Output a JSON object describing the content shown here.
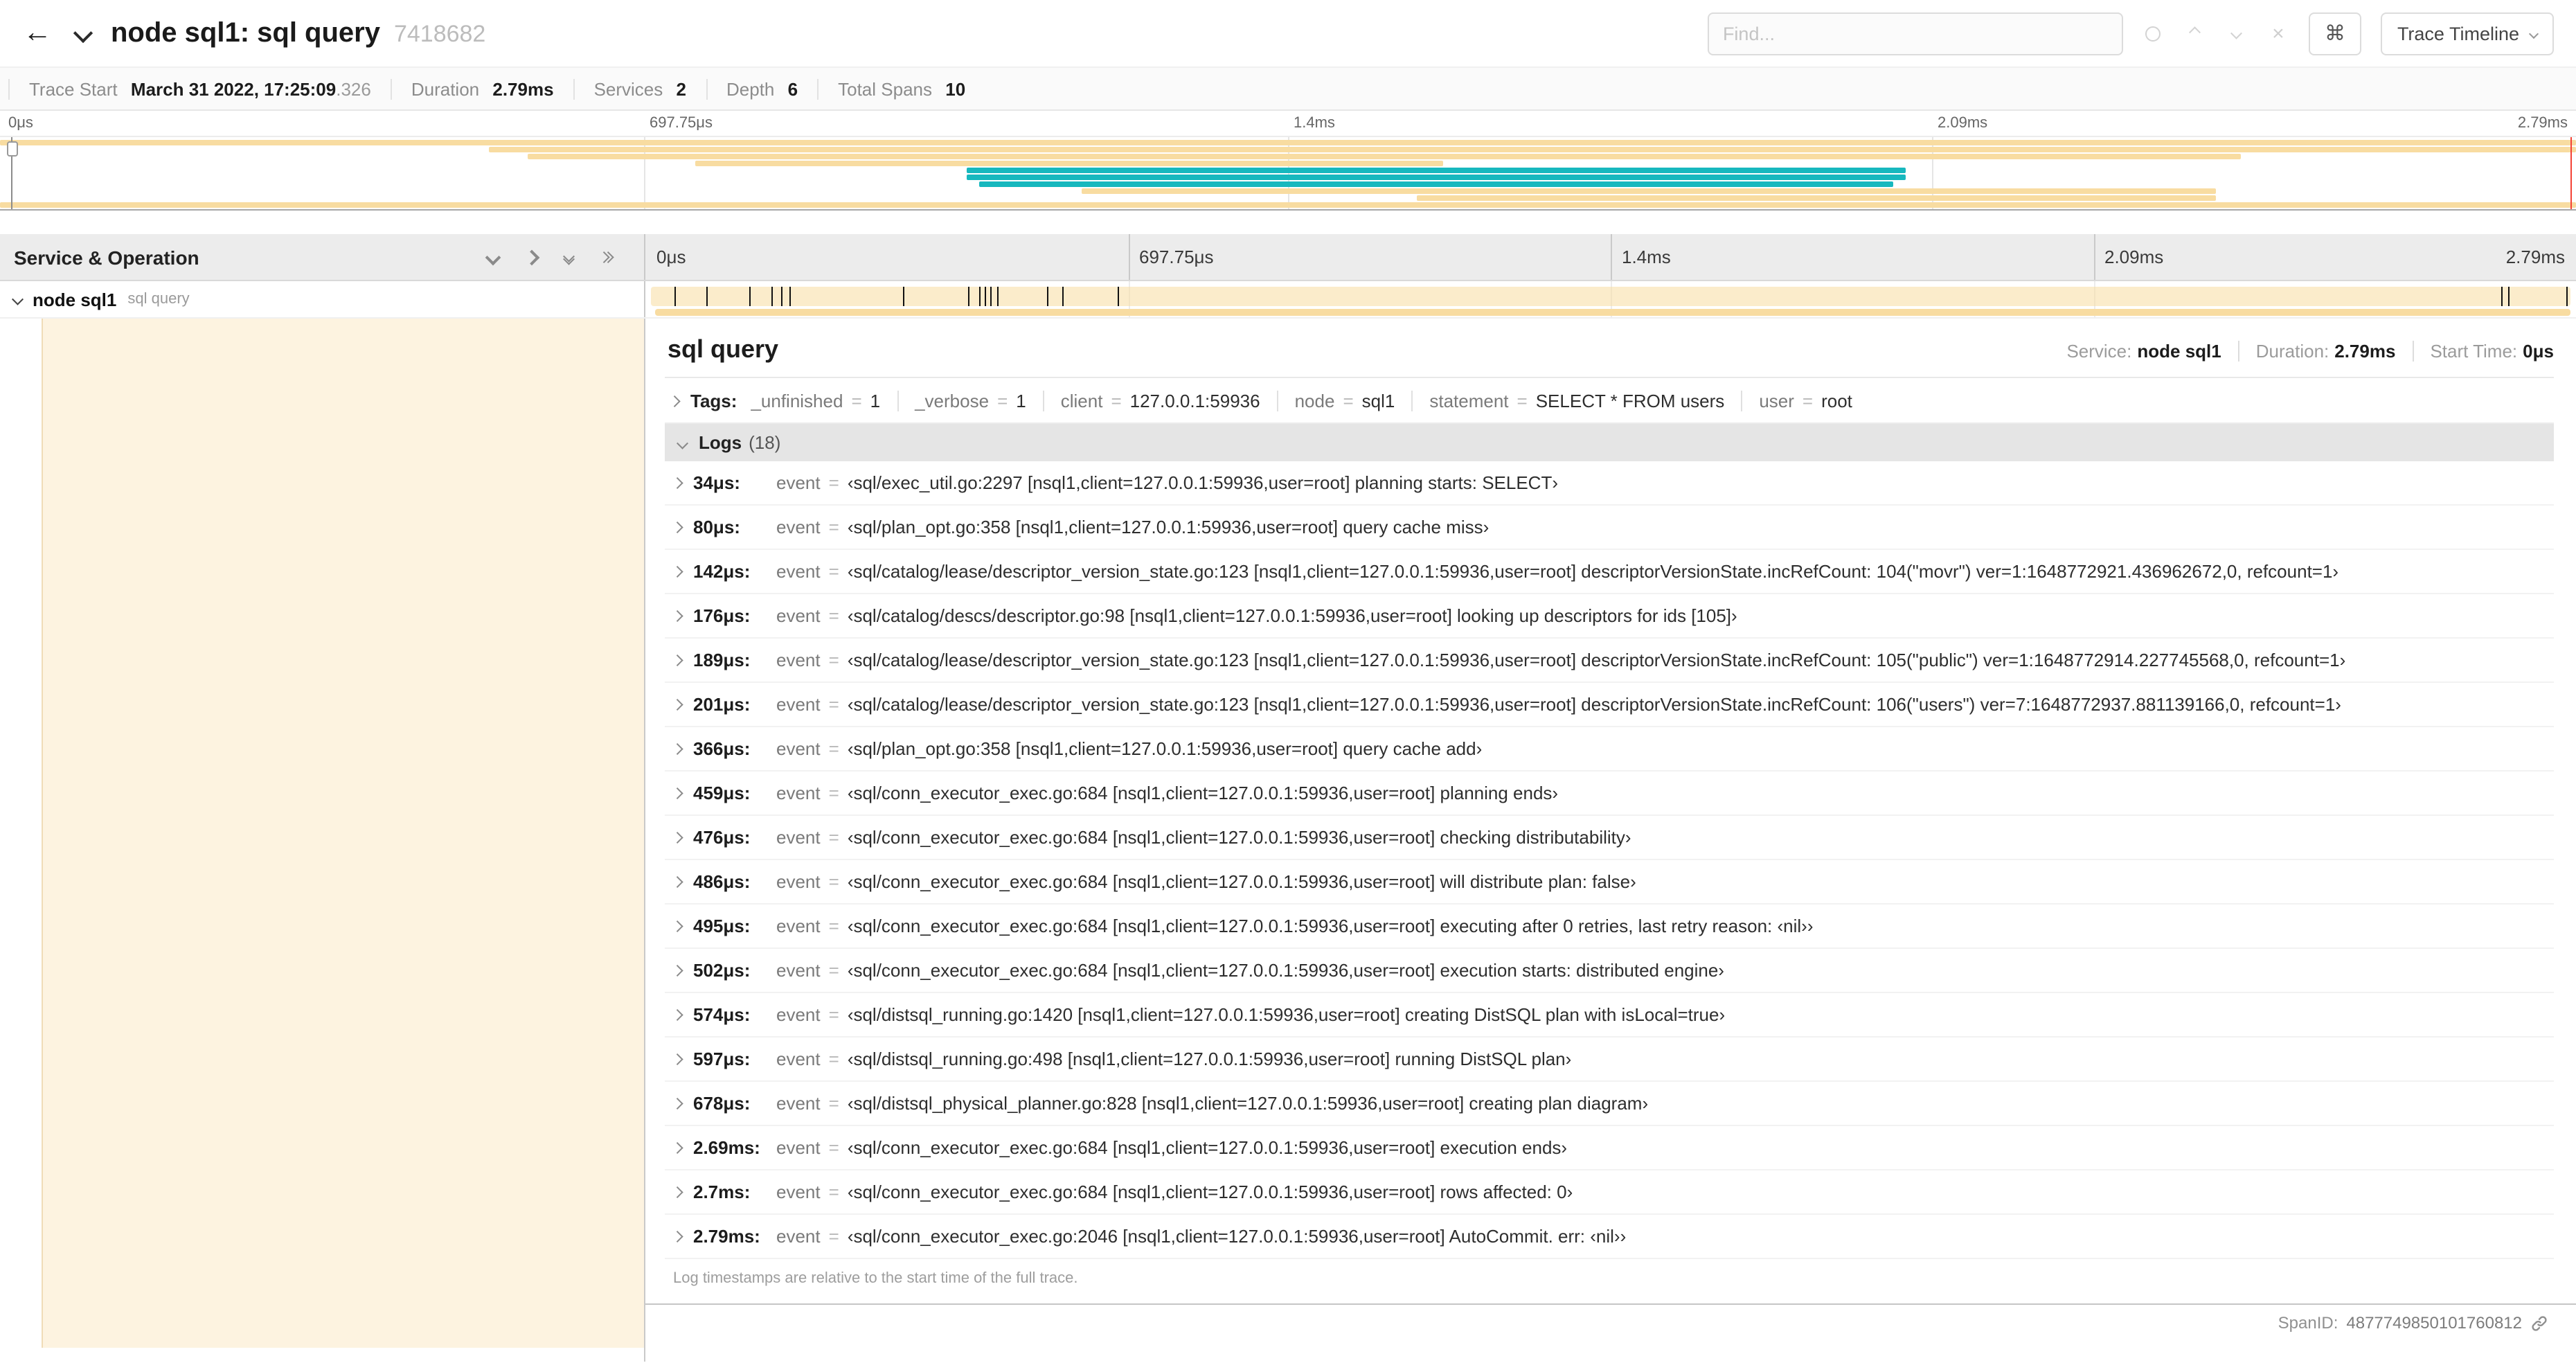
{
  "colors": {
    "span_tan": "#F8DCA1",
    "span_teal": "#17B8BE",
    "cursor": "#F44336"
  },
  "icons": {
    "back": "←",
    "command": "⌘",
    "clear": "×"
  },
  "header": {
    "title": "node sql1: sql query",
    "trace_id": "7418682",
    "find_placeholder": "Find...",
    "view_button": "Trace Timeline"
  },
  "summary": {
    "items": [
      {
        "label": "Trace Start",
        "value": "March 31 2022, 17:25:09",
        "suffix": ".326"
      },
      {
        "label": "Duration",
        "value": "2.79ms",
        "suffix": ""
      },
      {
        "label": "Services",
        "value": "2",
        "suffix": ""
      },
      {
        "label": "Depth",
        "value": "6",
        "suffix": ""
      },
      {
        "label": "Total Spans",
        "value": "10",
        "suffix": ""
      }
    ]
  },
  "minimap": {
    "ticks": [
      "0μs",
      "697.75μs",
      "1.4ms",
      "2.09ms",
      "2.79ms"
    ],
    "spans": [
      {
        "start": 0,
        "end": 100,
        "color": "span_tan"
      },
      {
        "start": 19,
        "end": 100,
        "color": "span_tan"
      },
      {
        "start": 20.5,
        "end": 87,
        "color": "span_tan"
      },
      {
        "start": 27,
        "end": 56,
        "color": "span_tan"
      },
      {
        "start": 37.5,
        "end": 74,
        "color": "span_teal"
      },
      {
        "start": 37.5,
        "end": 74,
        "color": "span_teal"
      },
      {
        "start": 38,
        "end": 73.5,
        "color": "span_teal"
      },
      {
        "start": 42,
        "end": 86,
        "color": "span_tan"
      },
      {
        "start": 55,
        "end": 86,
        "color": "span_tan"
      },
      {
        "start": 0,
        "end": 100,
        "color": "span_tan"
      }
    ]
  },
  "timeline": {
    "left_header": "Service & Operation",
    "ticks": [
      "0μs",
      "697.75μs",
      "1.4ms",
      "2.09ms",
      "2.79ms"
    ],
    "row": {
      "service": "node sql1",
      "operation": "sql query"
    },
    "log_marker_pcts": [
      1.2,
      2.9,
      5.1,
      6.3,
      6.8,
      7.2,
      13.1,
      16.5,
      17.1,
      17.4,
      17.7,
      18,
      20.6,
      21.4,
      24.3,
      96.4,
      96.8,
      99.8
    ]
  },
  "detail": {
    "operation": "sql query",
    "service_label": "Service:",
    "service": "node sql1",
    "duration_label": "Duration:",
    "duration": "2.79ms",
    "start_label": "Start Time:",
    "start": "0μs",
    "tags_label": "Tags:",
    "tags": [
      {
        "key": "_unfinished",
        "eq": "=",
        "value": "1"
      },
      {
        "key": "_verbose",
        "eq": "=",
        "value": "1"
      },
      {
        "key": "client",
        "eq": "=",
        "value": "127.0.0.1:59936"
      },
      {
        "key": "node",
        "eq": "=",
        "value": "sql1"
      },
      {
        "key": "statement",
        "eq": "=",
        "value": "SELECT * FROM users"
      },
      {
        "key": "user",
        "eq": "=",
        "value": "root"
      }
    ],
    "logs_label": "Logs",
    "logs_count": "(18)",
    "logs": [
      {
        "time": "34μs:",
        "key": "event",
        "eq": "=",
        "value": "‹sql/exec_util.go:2297 [nsql1,client=127.0.0.1:59936,user=root] planning starts: SELECT›"
      },
      {
        "time": "80μs:",
        "key": "event",
        "eq": "=",
        "value": "‹sql/plan_opt.go:358 [nsql1,client=127.0.0.1:59936,user=root] query cache miss›"
      },
      {
        "time": "142μs:",
        "key": "event",
        "eq": "=",
        "value": "‹sql/catalog/lease/descriptor_version_state.go:123 [nsql1,client=127.0.0.1:59936,user=root] descriptorVersionState.incRefCount: 104(\"movr\") ver=1:1648772921.436962672,0, refcount=1›"
      },
      {
        "time": "176μs:",
        "key": "event",
        "eq": "=",
        "value": "‹sql/catalog/descs/descriptor.go:98 [nsql1,client=127.0.0.1:59936,user=root] looking up descriptors for ids [105]›"
      },
      {
        "time": "189μs:",
        "key": "event",
        "eq": "=",
        "value": "‹sql/catalog/lease/descriptor_version_state.go:123 [nsql1,client=127.0.0.1:59936,user=root] descriptorVersionState.incRefCount: 105(\"public\") ver=1:1648772914.227745568,0, refcount=1›"
      },
      {
        "time": "201μs:",
        "key": "event",
        "eq": "=",
        "value": "‹sql/catalog/lease/descriptor_version_state.go:123 [nsql1,client=127.0.0.1:59936,user=root] descriptorVersionState.incRefCount: 106(\"users\") ver=7:1648772937.881139166,0, refcount=1›"
      },
      {
        "time": "366μs:",
        "key": "event",
        "eq": "=",
        "value": "‹sql/plan_opt.go:358 [nsql1,client=127.0.0.1:59936,user=root] query cache add›"
      },
      {
        "time": "459μs:",
        "key": "event",
        "eq": "=",
        "value": "‹sql/conn_executor_exec.go:684 [nsql1,client=127.0.0.1:59936,user=root] planning ends›"
      },
      {
        "time": "476μs:",
        "key": "event",
        "eq": "=",
        "value": "‹sql/conn_executor_exec.go:684 [nsql1,client=127.0.0.1:59936,user=root] checking distributability›"
      },
      {
        "time": "486μs:",
        "key": "event",
        "eq": "=",
        "value": "‹sql/conn_executor_exec.go:684 [nsql1,client=127.0.0.1:59936,user=root] will distribute plan: false›"
      },
      {
        "time": "495μs:",
        "key": "event",
        "eq": "=",
        "value": "‹sql/conn_executor_exec.go:684 [nsql1,client=127.0.0.1:59936,user=root] executing after 0 retries, last retry reason: ‹nil››"
      },
      {
        "time": "502μs:",
        "key": "event",
        "eq": "=",
        "value": "‹sql/conn_executor_exec.go:684 [nsql1,client=127.0.0.1:59936,user=root] execution starts: distributed engine›"
      },
      {
        "time": "574μs:",
        "key": "event",
        "eq": "=",
        "value": "‹sql/distsql_running.go:1420 [nsql1,client=127.0.0.1:59936,user=root] creating DistSQL plan with isLocal=true›"
      },
      {
        "time": "597μs:",
        "key": "event",
        "eq": "=",
        "value": "‹sql/distsql_running.go:498 [nsql1,client=127.0.0.1:59936,user=root] running DistSQL plan›"
      },
      {
        "time": "678μs:",
        "key": "event",
        "eq": "=",
        "value": "‹sql/distsql_physical_planner.go:828 [nsql1,client=127.0.0.1:59936,user=root] creating plan diagram›"
      },
      {
        "time": "2.69ms:",
        "key": "event",
        "eq": "=",
        "value": "‹sql/conn_executor_exec.go:684 [nsql1,client=127.0.0.1:59936,user=root] execution ends›"
      },
      {
        "time": "2.7ms:",
        "key": "event",
        "eq": "=",
        "value": "‹sql/conn_executor_exec.go:684 [nsql1,client=127.0.0.1:59936,user=root] rows affected: 0›"
      },
      {
        "time": "2.79ms:",
        "key": "event",
        "eq": "=",
        "value": "‹sql/conn_executor_exec.go:2046 [nsql1,client=127.0.0.1:59936,user=root] AutoCommit. err: ‹nil››"
      }
    ],
    "logs_note": "Log timestamps are relative to the start time of the full trace.",
    "span_id_label": "SpanID:",
    "span_id": "4877749850101760812"
  }
}
